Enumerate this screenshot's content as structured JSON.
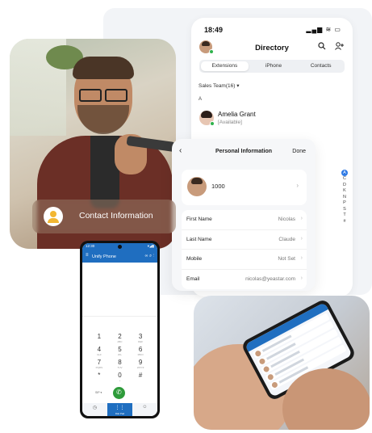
{
  "directory": {
    "status_time": "18:49",
    "status_icons": "▂▄▆ ≋ ▭",
    "title": "Directory",
    "tabs": [
      {
        "label": "Extensions",
        "active": true
      },
      {
        "label": "iPhone",
        "active": false
      },
      {
        "label": "Contacts",
        "active": false
      }
    ],
    "team_filter": "Sales Team(16) ▾",
    "section_letter": "A",
    "contact": {
      "name": "Amelia Grant",
      "status": "[Available]"
    },
    "alpha_index": [
      "A",
      "C",
      "D",
      "K",
      "N",
      "P",
      "S",
      "T",
      "#"
    ],
    "icons": {
      "search": "search-icon",
      "add_user": "add-user-icon"
    }
  },
  "personal_info": {
    "back": "‹",
    "title": "Personal Information",
    "done": "Done",
    "extension": "1000",
    "fields": [
      {
        "label": "First Name",
        "value": "Nicolas"
      },
      {
        "label": "Last Name",
        "value": "Claude"
      },
      {
        "label": "Mobile",
        "value": "Not Set"
      },
      {
        "label": "Email",
        "value": "nicolas@yeastar.com"
      }
    ]
  },
  "contact_pill": {
    "label": "Contact Information"
  },
  "android": {
    "time": "12:30",
    "signal": "▾◢▮",
    "title": "Unify Phone",
    "menu": "≡",
    "actions": "∞ ⌕ ⋮",
    "keys": [
      {
        "num": "1",
        "sub": ""
      },
      {
        "num": "2",
        "sub": "ABC"
      },
      {
        "num": "3",
        "sub": "DEF"
      },
      {
        "num": "4",
        "sub": "GHI"
      },
      {
        "num": "5",
        "sub": "JKL"
      },
      {
        "num": "6",
        "sub": "MNO"
      },
      {
        "num": "7",
        "sub": "PQRS"
      },
      {
        "num": "8",
        "sub": "TUV"
      },
      {
        "num": "9",
        "sub": "WXYZ"
      },
      {
        "num": "*",
        "sub": ""
      },
      {
        "num": "0",
        "sub": "+"
      },
      {
        "num": "#",
        "sub": ""
      }
    ],
    "call_log": "SIP ▾",
    "nav": [
      {
        "glyph": "◷",
        "label": "",
        "active": false
      },
      {
        "glyph": "⋮⋮",
        "label": "Dial Pad",
        "active": true
      },
      {
        "glyph": "☺",
        "label": "",
        "active": false
      }
    ]
  }
}
